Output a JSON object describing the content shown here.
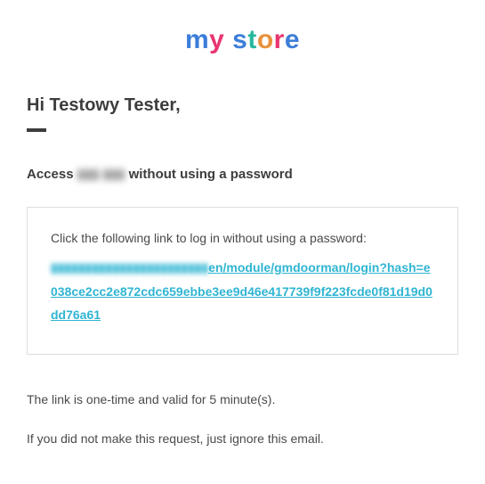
{
  "logo": {
    "chars": [
      "m",
      "y",
      " ",
      "s",
      "t",
      "o",
      "r",
      "e"
    ]
  },
  "greeting": "Hi Testowy Tester,",
  "subtitle": {
    "prefix": "Access ",
    "blurred": "▮▮▮ ▮▮▮",
    "suffix": " without using a password"
  },
  "linkBox": {
    "intro": "Click the following link to log in without using a password:",
    "url_blurred": "▮▮▮▮▮▮▮▮▮▮▮▮▮▮▮▮▮▮▮▮▮▮▮",
    "url_visible": "en/module/gmdoorman/login?hash=e038ce2cc2e872cdc659ebbe3ee9d46e417739f9f223fcde0f81d19d0dd76a61"
  },
  "footer": {
    "validity": "The link is one-time and valid for 5 minute(s).",
    "ignore": "If you did not make this request, just ignore this email."
  }
}
